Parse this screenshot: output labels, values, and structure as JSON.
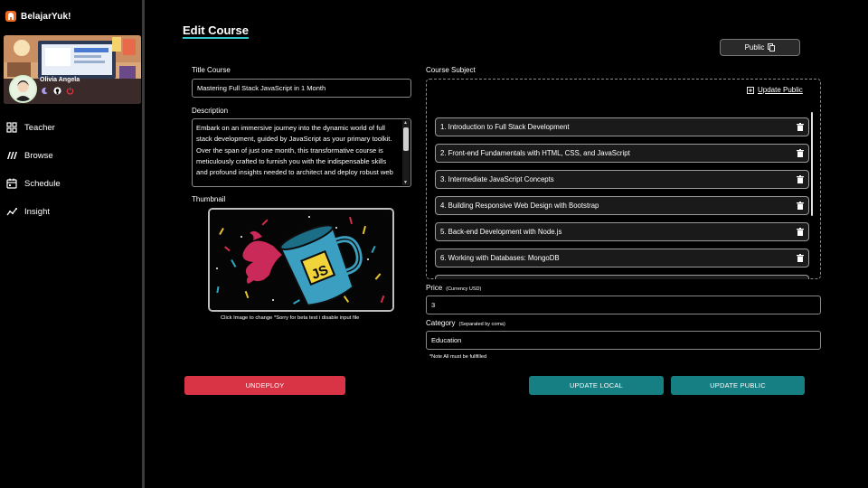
{
  "brand": {
    "name": "BelajarYuk!"
  },
  "profile": {
    "name": "Olivia Angela",
    "icons": [
      "moon-icon",
      "github-icon",
      "power-icon"
    ]
  },
  "nav": [
    {
      "label": "Teacher",
      "icon": "grid-icon"
    },
    {
      "label": "Browse",
      "icon": "browse-icon"
    },
    {
      "label": "Schedule",
      "icon": "calendar-icon"
    },
    {
      "label": "Insight",
      "icon": "chart-line-icon"
    }
  ],
  "page": {
    "title": "Edit Course"
  },
  "public_button": {
    "label": "Public",
    "icon": "copy-icon"
  },
  "form": {
    "title_label": "Title Course",
    "title_value": "Mastering Full Stack JavaScript in 1 Month",
    "description_label": "Description",
    "description_value": "Embark on an immersive journey into the dynamic world of full stack development, guided by JavaScript as your primary toolkit. Over the span of just one month, this transformative course is meticulously crafted to furnish you with the indispensable skills and profound insights needed to architect and deploy robust web",
    "thumbnail_label": "Thumbnail",
    "thumbnail_caption": "Click Image to change *Sorry for beta test i disable input file",
    "thumbnail_logo_text": "JS",
    "subject_label": "Course Subject",
    "update_public_link": "Update Public",
    "subjects": [
      "1. Introduction to Full Stack Development",
      "2. Front-end Fundamentals with HTML, CSS, and JavaScript",
      "3. Intermediate JavaScript Concepts",
      "4. Building Responsive Web Design with Bootstrap",
      "5. Back-end Development with Node.js",
      "6. Working with Databases: MongoDB"
    ],
    "price_label": "Price",
    "price_hint": "(Currency USD)",
    "price_value": "3",
    "category_label": "Category",
    "category_hint": "(Separated by coma)",
    "category_value": "Education",
    "note": "*Note All must be fullfilled"
  },
  "buttons": {
    "undeploy": "UNDEPLOY",
    "update_local": "UPDATE LOCAL",
    "update_public": "UPDATE PUBLIC"
  },
  "colors": {
    "accent_teal": "#167f84",
    "danger_red": "#d93446",
    "title_underline": "#2ec4c8",
    "brand_orange": "#f26a21"
  }
}
